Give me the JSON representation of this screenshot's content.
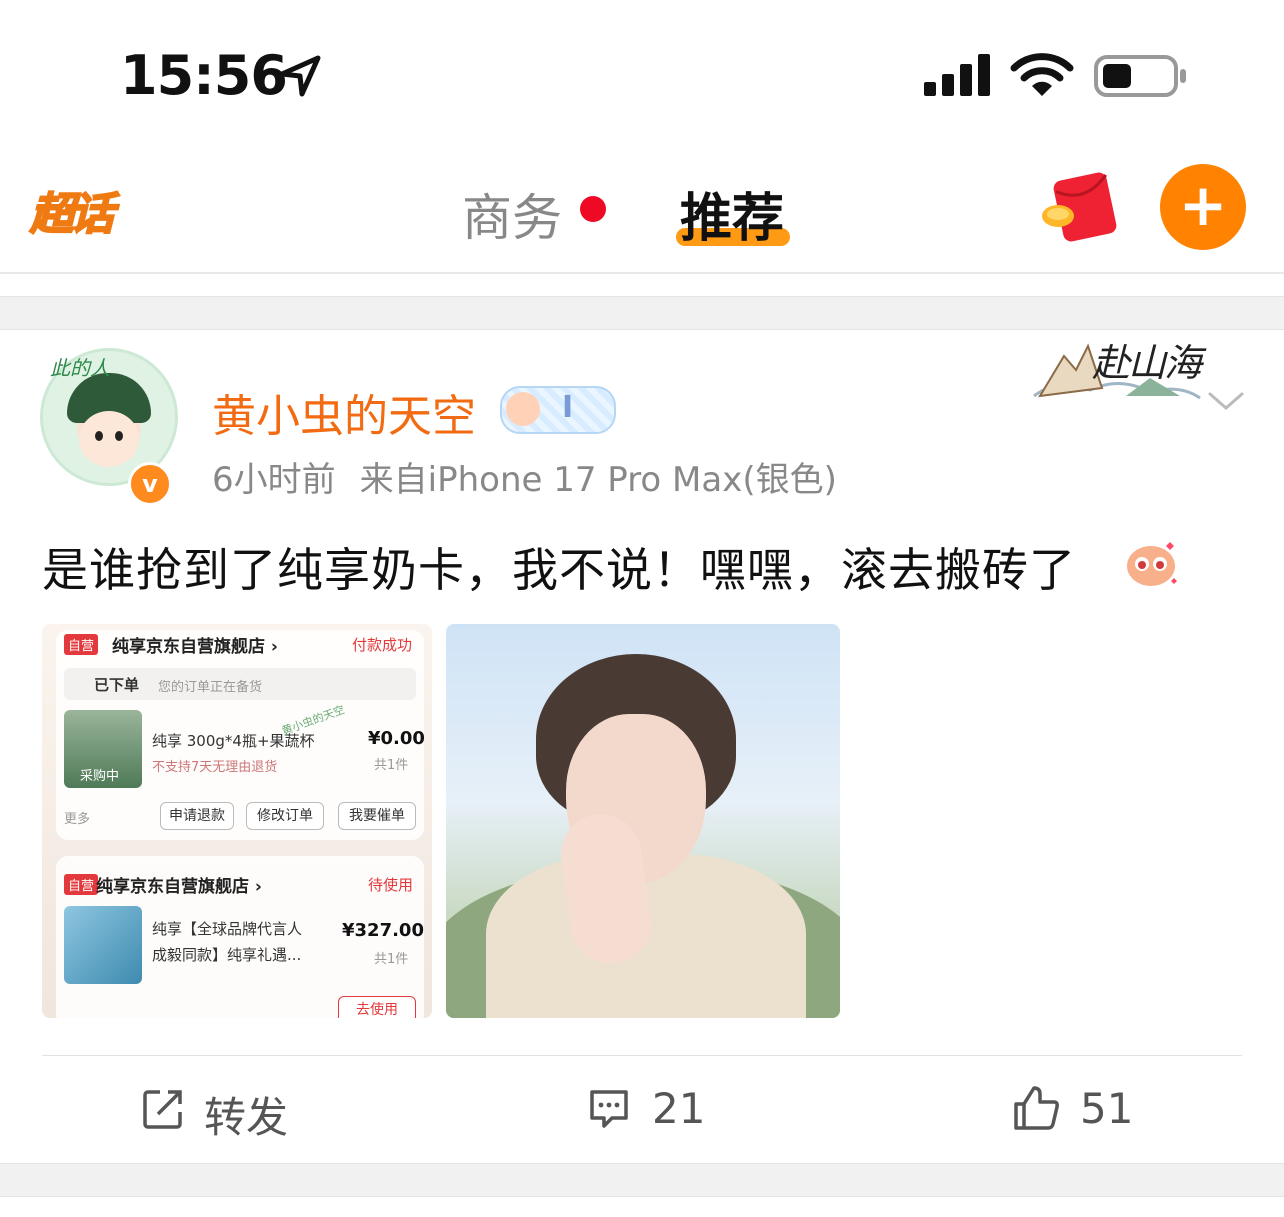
{
  "status_bar": {
    "time": "15:56"
  },
  "nav": {
    "logo_text": "超话",
    "tabs": [
      {
        "label": "商务",
        "has_dot": true
      },
      {
        "label": "推荐",
        "active": true
      }
    ],
    "accent_color": "#ff8200"
  },
  "post": {
    "avatar_frame_text": "此的人",
    "verified_mark": "v",
    "username": "黄小虫的天空",
    "member_badge_text": "I",
    "time": "6小时前",
    "source": "来自iPhone 17 Pro Max(银色)",
    "decor_logo_text": "赴山海",
    "text": "是谁抢到了纯享奶卡，我不说！嘿嘿，滚去搬砖了",
    "image_1": {
      "card_1": {
        "tag": "自营",
        "shop": "纯享京东自营旗舰店 ›",
        "status": "付款成功",
        "order_status": "已下单",
        "order_note": "您的订单正在备货",
        "thumb_label": "采购中",
        "product": "纯享 300g*4瓶+果蔬杯",
        "product_note": "不支持7天无理由退货",
        "price": "¥0.00",
        "qty": "共1件",
        "more": "更多",
        "buttons": [
          "申请退款",
          "修改订单",
          "我要催单"
        ]
      },
      "card_2": {
        "tag": "自营",
        "shop": "纯享京东自营旗舰店 ›",
        "status": "待使用",
        "product_line1": "纯享【全球品牌代言人",
        "product_line2": "成毅同款】纯享礼遇...",
        "price": "¥327.00",
        "qty": "共1件",
        "button": "去使用"
      },
      "watermark": "黄小虫的天空"
    },
    "actions": {
      "repost_label": "转发",
      "comment_count": "21",
      "like_count": "51"
    }
  }
}
